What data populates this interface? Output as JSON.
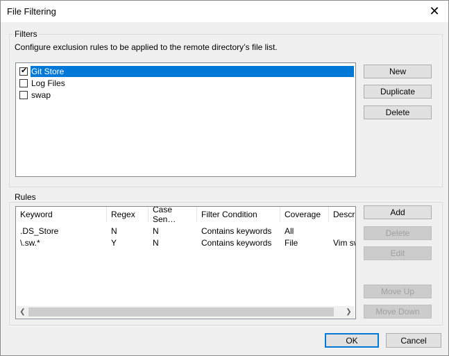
{
  "window": {
    "title": "File Filtering"
  },
  "filters": {
    "legend": "Filters",
    "description": "Configure exclusion rules to be applied to the remote directory’s file list.",
    "items": [
      {
        "label": "Git Store",
        "checked": true,
        "selected": true
      },
      {
        "label": "Log Files",
        "checked": false,
        "selected": false
      },
      {
        "label": "swap",
        "checked": false,
        "selected": false
      }
    ],
    "buttons": {
      "new": "New",
      "duplicate": "Duplicate",
      "delete": "Delete"
    }
  },
  "rules": {
    "legend": "Rules",
    "columns": [
      "Keyword",
      "Regex",
      "Case Sen…",
      "Filter Condition",
      "Coverage",
      "Descrip"
    ],
    "rows": [
      [
        ".DS_Store",
        "N",
        "N",
        "Contains keywords",
        "All",
        ""
      ],
      [
        "\\.sw.*",
        "Y",
        "N",
        "Contains keywords",
        "File",
        "Vim sw"
      ]
    ],
    "buttons": {
      "add": "Add",
      "delete": "Delete",
      "edit": "Edit",
      "move_up": "Move Up",
      "move_down": "Move Down"
    }
  },
  "footer": {
    "ok": "OK",
    "cancel": "Cancel"
  },
  "icons": {
    "close": "close-icon",
    "check": "check-icon",
    "scroll_left": "chevron-left-icon",
    "scroll_right": "chevron-right-icon"
  },
  "colors": {
    "selection": "#0078d7",
    "disabled_text": "#a0a0a0"
  }
}
